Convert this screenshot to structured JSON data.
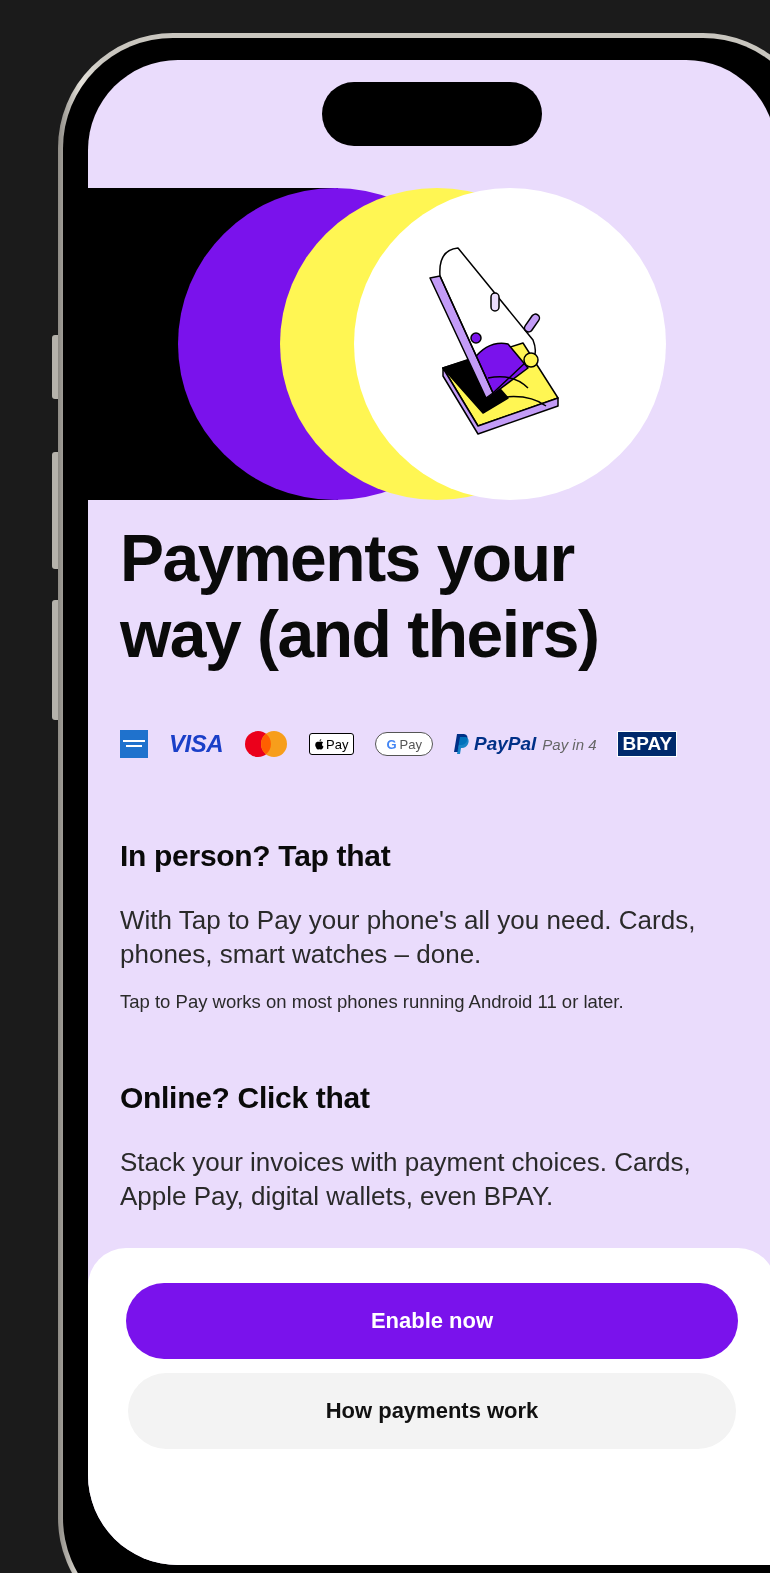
{
  "title": "Payments your way (and theirs)",
  "payment_logos": [
    {
      "kind": "amex"
    },
    {
      "kind": "visa",
      "text": "VISA"
    },
    {
      "kind": "mastercard"
    },
    {
      "kind": "applepay",
      "text": "Pay"
    },
    {
      "kind": "googlepay",
      "mark": "G",
      "text": "Pay"
    },
    {
      "kind": "paypal",
      "text": "PayPal",
      "extra": "Pay in 4"
    },
    {
      "kind": "bpay",
      "text": "BPAY"
    }
  ],
  "sections": [
    {
      "heading": "In person? Tap that",
      "body": "With Tap to Pay your phone's all you need. Cards, phones, smart watches – done.",
      "note": "Tap to Pay works on most phones running Android 11 or later."
    },
    {
      "heading": "Online? Click that",
      "body": "Stack your invoices with payment choices. Cards, Apple Pay, digital wallets, even BPAY."
    }
  ],
  "buttons": [
    {
      "label": "Enable now",
      "kind": "primary"
    },
    {
      "label": "How payments work",
      "kind": "secondary"
    }
  ]
}
